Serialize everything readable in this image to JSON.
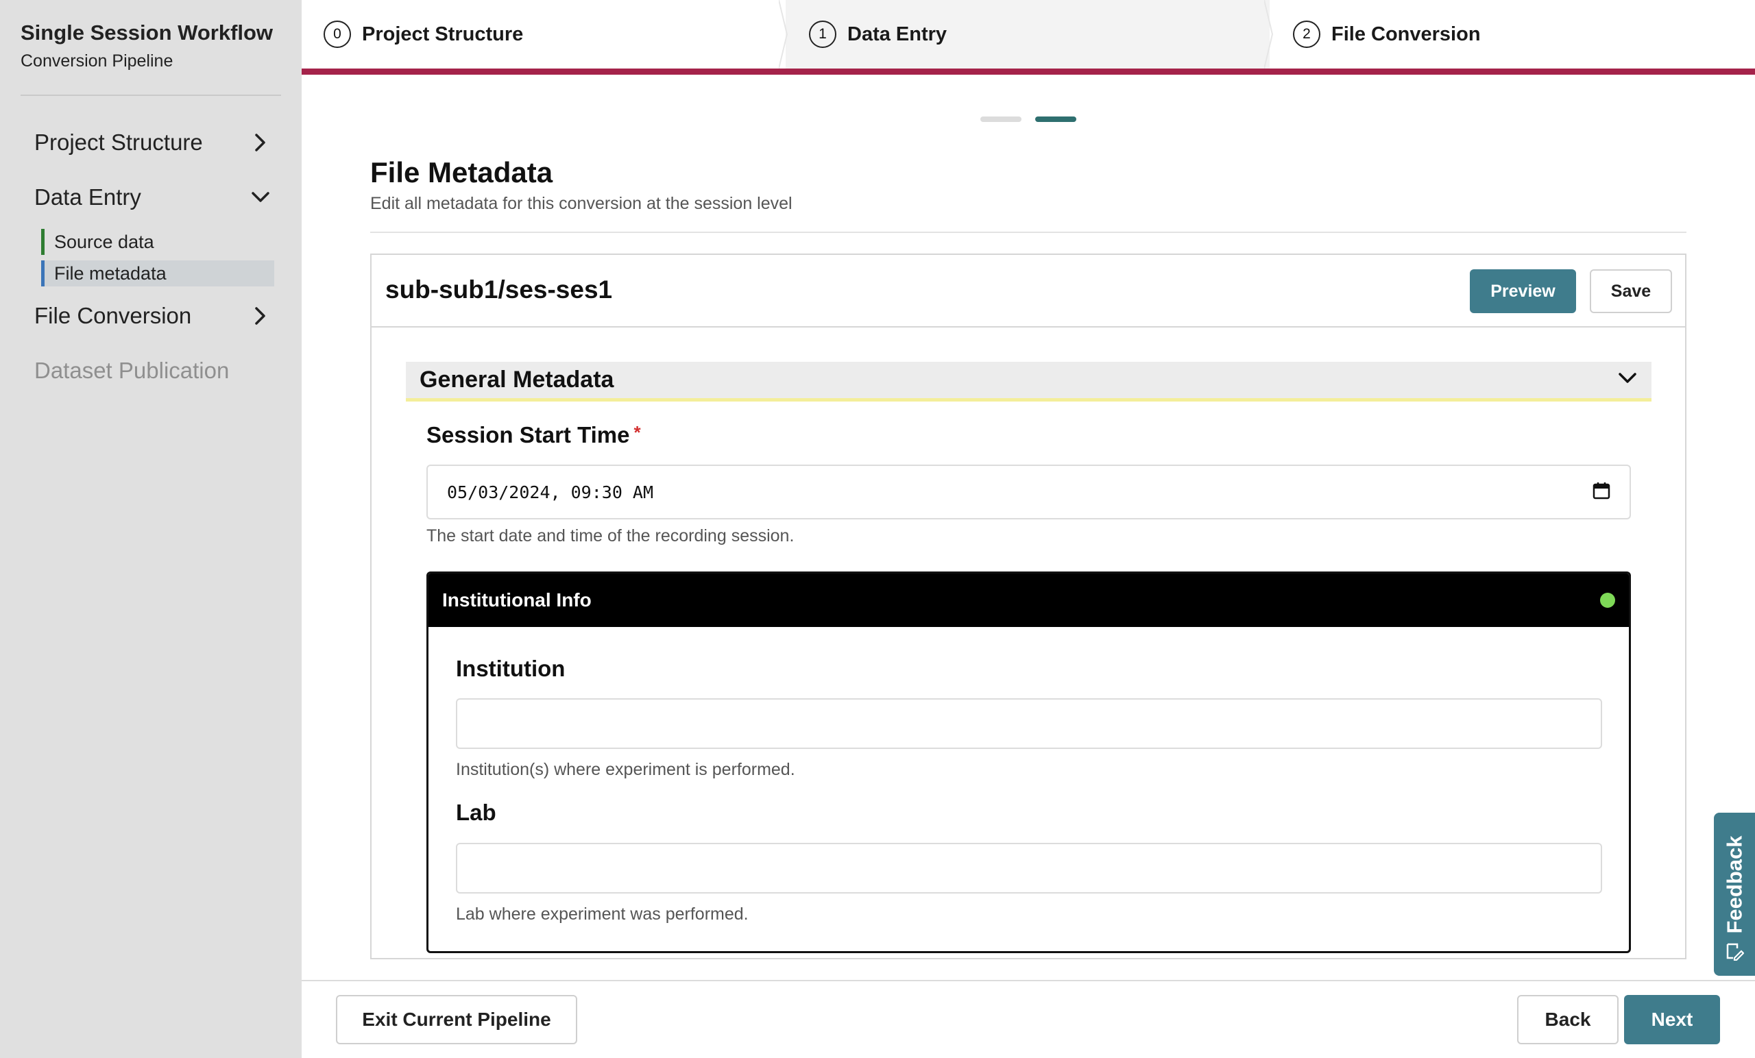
{
  "sidebar": {
    "title": "Single Session Workflow",
    "subtitle": "Conversion Pipeline",
    "items": [
      {
        "label": "Project Structure",
        "state": "collapsed"
      },
      {
        "label": "Data Entry",
        "state": "expanded",
        "children": [
          {
            "label": "Source data"
          },
          {
            "label": "File metadata",
            "active": true
          }
        ]
      },
      {
        "label": "File Conversion",
        "state": "collapsed"
      },
      {
        "label": "Dataset Publication",
        "state": "disabled"
      }
    ]
  },
  "stepper": {
    "steps": [
      {
        "number": "0",
        "label": "Project Structure"
      },
      {
        "number": "1",
        "label": "Data Entry"
      },
      {
        "number": "2",
        "label": "File Conversion"
      }
    ],
    "accent_color": "#a5234a"
  },
  "page": {
    "title": "File Metadata",
    "description": "Edit all metadata for this conversion at the session level",
    "dots": {
      "total": 2,
      "active": 2
    }
  },
  "session": {
    "name": "sub-sub1/ses-ses1",
    "preview_label": "Preview",
    "save_label": "Save"
  },
  "general": {
    "title": "General Metadata",
    "session_start_time": {
      "label": "Session Start Time",
      "required_mark": "*",
      "value": "05/03/2024, 09:30 AM",
      "description": "The start date and time of the recording session."
    }
  },
  "institutional": {
    "title": "Institutional Info",
    "status_color": "#7ed957",
    "institution": {
      "label": "Institution",
      "value": "",
      "description": "Institution(s) where experiment is performed."
    },
    "lab": {
      "label": "Lab",
      "value": "",
      "description": "Lab where experiment was performed."
    }
  },
  "footer": {
    "exit_label": "Exit Current Pipeline",
    "back_label": "Back",
    "next_label": "Next"
  },
  "feedback": {
    "label": "Feedback"
  },
  "colors": {
    "primary_button": "#3f7c8c",
    "sidebar_bg": "#e0e0e0"
  }
}
